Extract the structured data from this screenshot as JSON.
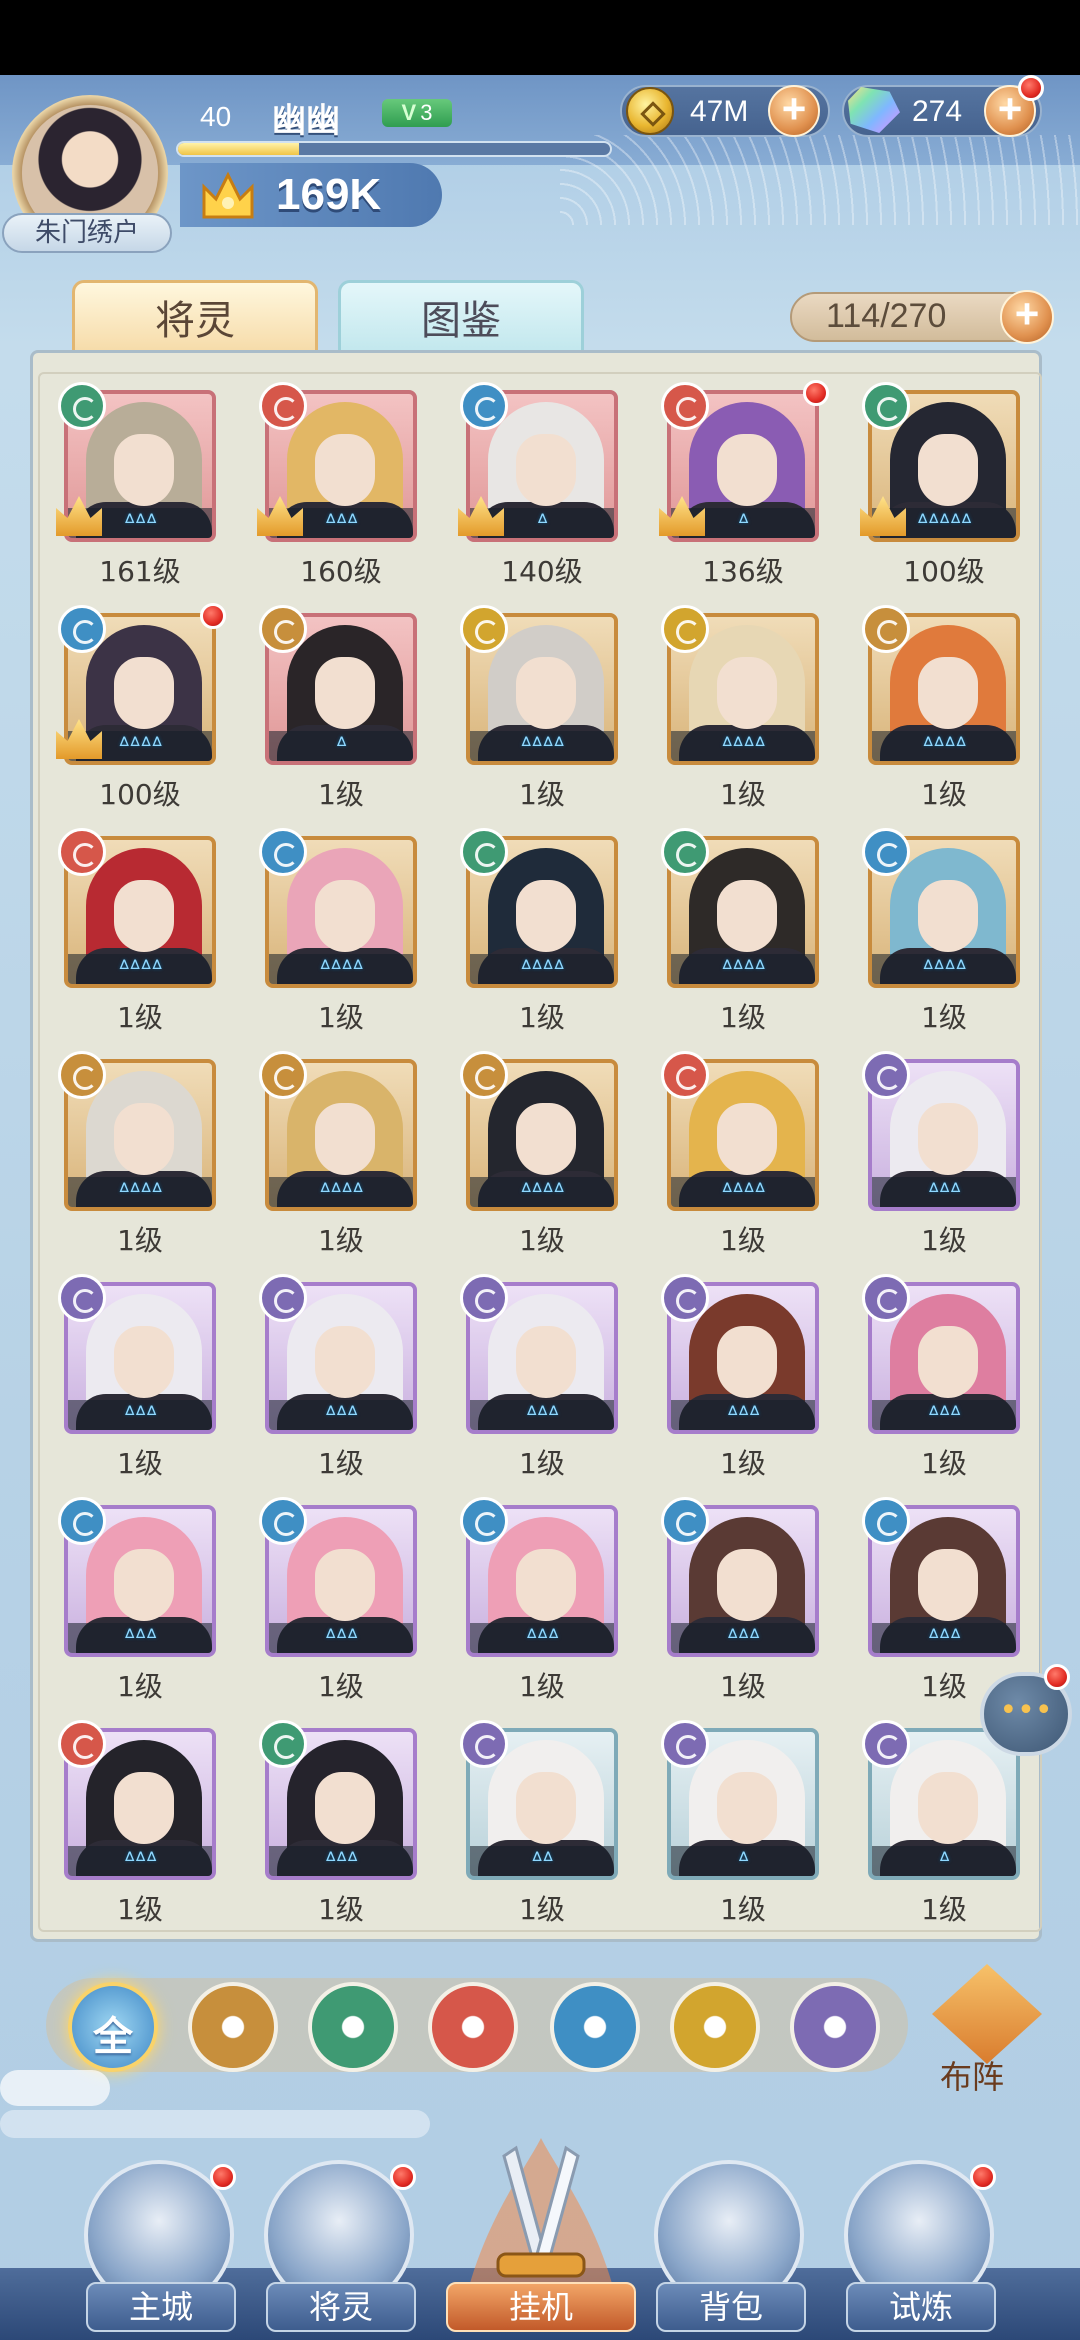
{
  "player": {
    "level": "40",
    "name": "幽幽",
    "vip_prefix": "V",
    "vip_level": "3",
    "title": "朱门绣户",
    "power": "169K",
    "xp_fraction": 0.28
  },
  "resources": {
    "gold": "47M",
    "gems": "274",
    "plus": "+"
  },
  "tabs": {
    "active": "将灵",
    "idle": "图鉴"
  },
  "collection": {
    "count": "114/270",
    "plus": "+"
  },
  "characters": [
    {
      "level": "161级",
      "frame": "red",
      "element": "wind",
      "crown": true,
      "hair": "#b8ad98",
      "stars": "ᐞᐞᐞ"
    },
    {
      "level": "160级",
      "frame": "red",
      "element": "fire",
      "crown": true,
      "hair": "#e2b765",
      "stars": "ᐞᐞᐞ"
    },
    {
      "level": "140级",
      "frame": "red",
      "element": "water",
      "crown": true,
      "hair": "#e8e6e4",
      "stars": "ᐞ"
    },
    {
      "level": "136级",
      "frame": "red",
      "element": "fire",
      "crown": true,
      "hair": "#8a5cb3",
      "stars": "ᐞ",
      "dot": true
    },
    {
      "level": "100级",
      "frame": "gold",
      "element": "wind",
      "crown": true,
      "hair": "#252732",
      "stars": "ᐞᐞᐞᐞᐞ"
    },
    {
      "level": "100级",
      "frame": "gold",
      "element": "water",
      "crown": true,
      "hair": "#3c3346",
      "stars": "ᐞᐞᐞᐞ",
      "dot": true
    },
    {
      "level": "1级",
      "frame": "red",
      "element": "earth",
      "crown": false,
      "hair": "#2a2528",
      "stars": "ᐞ"
    },
    {
      "level": "1级",
      "frame": "gold",
      "element": "light",
      "crown": false,
      "hair": "#d1cdc8",
      "stars": "ᐞᐞᐞᐞ"
    },
    {
      "level": "1级",
      "frame": "gold",
      "element": "light",
      "crown": false,
      "hair": "#e7d7b4",
      "stars": "ᐞᐞᐞᐞ"
    },
    {
      "level": "1级",
      "frame": "gold",
      "element": "earth",
      "crown": false,
      "hair": "#e07a3c",
      "stars": "ᐞᐞᐞᐞ"
    },
    {
      "level": "1级",
      "frame": "gold",
      "element": "fire",
      "crown": false,
      "hair": "#b82a32",
      "stars": "ᐞᐞᐞᐞ"
    },
    {
      "level": "1级",
      "frame": "gold",
      "element": "water",
      "crown": false,
      "hair": "#eaa5b8",
      "stars": "ᐞᐞᐞᐞ"
    },
    {
      "level": "1级",
      "frame": "gold",
      "element": "wind",
      "crown": false,
      "hair": "#1f2b3a",
      "stars": "ᐞᐞᐞᐞ"
    },
    {
      "level": "1级",
      "frame": "gold",
      "element": "wind",
      "crown": false,
      "hair": "#2e2a28",
      "stars": "ᐞᐞᐞᐞ"
    },
    {
      "level": "1级",
      "frame": "gold",
      "element": "water",
      "crown": false,
      "hair": "#7fb8cf",
      "stars": "ᐞᐞᐞᐞ"
    },
    {
      "level": "1级",
      "frame": "gold",
      "element": "earth",
      "crown": false,
      "hair": "#dcd8d0",
      "stars": "ᐞᐞᐞᐞ"
    },
    {
      "level": "1级",
      "frame": "gold",
      "element": "earth",
      "crown": false,
      "hair": "#d9b46a",
      "stars": "ᐞᐞᐞᐞ"
    },
    {
      "level": "1级",
      "frame": "gold",
      "element": "earth",
      "crown": false,
      "hair": "#24262e",
      "stars": "ᐞᐞᐞᐞ"
    },
    {
      "level": "1级",
      "frame": "gold",
      "element": "fire",
      "crown": false,
      "hair": "#e4b44d",
      "stars": "ᐞᐞᐞᐞ"
    },
    {
      "level": "1级",
      "frame": "purple",
      "element": "void",
      "crown": false,
      "hair": "#eceaf0",
      "stars": "ᐞᐞᐞ"
    },
    {
      "level": "1级",
      "frame": "purple",
      "element": "void",
      "crown": false,
      "hair": "#eceaf0",
      "stars": "ᐞᐞᐞ"
    },
    {
      "level": "1级",
      "frame": "purple",
      "element": "void",
      "crown": false,
      "hair": "#eceaf0",
      "stars": "ᐞᐞᐞ"
    },
    {
      "level": "1级",
      "frame": "purple",
      "element": "void",
      "crown": false,
      "hair": "#eceaf0",
      "stars": "ᐞᐞᐞ"
    },
    {
      "level": "1级",
      "frame": "purple",
      "element": "void",
      "crown": false,
      "hair": "#7a3a2c",
      "stars": "ᐞᐞᐞ"
    },
    {
      "level": "1级",
      "frame": "purple",
      "element": "void",
      "crown": false,
      "hair": "#de7ea0",
      "stars": "ᐞᐞᐞ"
    },
    {
      "level": "1级",
      "frame": "purple",
      "element": "water",
      "crown": false,
      "hair": "#ee9fb6",
      "stars": "ᐞᐞᐞ"
    },
    {
      "level": "1级",
      "frame": "purple",
      "element": "water",
      "crown": false,
      "hair": "#ee9fb6",
      "stars": "ᐞᐞᐞ"
    },
    {
      "level": "1级",
      "frame": "purple",
      "element": "water",
      "crown": false,
      "hair": "#ee9fb6",
      "stars": "ᐞᐞᐞ"
    },
    {
      "level": "1级",
      "frame": "purple",
      "element": "water",
      "crown": false,
      "hair": "#5a3a34",
      "stars": "ᐞᐞᐞ"
    },
    {
      "level": "1级",
      "frame": "purple",
      "element": "water",
      "crown": false,
      "hair": "#5a3a34",
      "stars": "ᐞᐞᐞ"
    },
    {
      "level": "1级",
      "frame": "purple",
      "element": "fire",
      "crown": false,
      "hair": "#24232a",
      "stars": "ᐞᐞᐞ"
    },
    {
      "level": "1级",
      "frame": "purple",
      "element": "wind",
      "crown": false,
      "hair": "#25232c",
      "stars": "ᐞᐞᐞ"
    },
    {
      "level": "1级",
      "frame": "blue",
      "element": "void",
      "crown": false,
      "hair": "#f1efee",
      "stars": "ᐞᐞ"
    },
    {
      "level": "1级",
      "frame": "blue",
      "element": "void",
      "crown": false,
      "hair": "#f1efee",
      "stars": "ᐞ"
    },
    {
      "level": "1级",
      "frame": "blue",
      "element": "void",
      "crown": false,
      "hair": "#f1efee",
      "stars": "ᐞ"
    }
  ],
  "element_colors": {
    "wind": "#3f9a73",
    "fire": "#d6574a",
    "water": "#3f8fc4",
    "earth": "#c78f3c",
    "light": "#d2a52e",
    "void": "#7d6bb3"
  },
  "filters": {
    "all_label": "全",
    "items": [
      "all",
      "earth",
      "wind",
      "fire",
      "water",
      "light",
      "void"
    ]
  },
  "formation_label": "布阵",
  "chat_icon": "•••",
  "nav": [
    {
      "label": "主城",
      "icon": "castle-icon",
      "dot": true
    },
    {
      "label": "将灵",
      "icon": "helmet-icon",
      "dot": true
    },
    {
      "label": "挂机",
      "icon": "swords-icon",
      "dot": false,
      "active": true
    },
    {
      "label": "背包",
      "icon": "bag-icon",
      "dot": false
    },
    {
      "label": "试炼",
      "icon": "banner-icon",
      "dot": true
    }
  ]
}
